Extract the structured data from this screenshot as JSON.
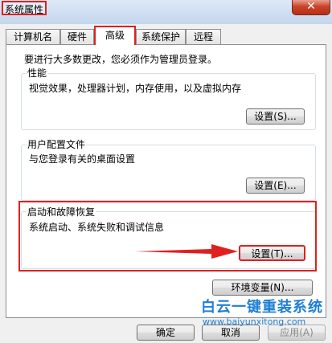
{
  "window": {
    "title": "系统属性",
    "close_glyph": "✕"
  },
  "tabs": [
    {
      "label": "计算机名"
    },
    {
      "label": "硬件"
    },
    {
      "label": "高级"
    },
    {
      "label": "系统保护"
    },
    {
      "label": "远程"
    }
  ],
  "active_tab": "高级",
  "admin_note": "要进行大多数更改，您必须作为管理员登录。",
  "groups": {
    "performance": {
      "label": "性能",
      "description": "视觉效果，处理器计划，内存使用，以及虚拟内存",
      "button": "设置(S)..."
    },
    "user_profiles": {
      "label": "用户配置文件",
      "description": "与您登录有关的桌面设置",
      "button": "设置(E)..."
    },
    "startup_recovery": {
      "label": "启动和故障恢复",
      "description": "系统启动、系统失败和调试信息",
      "button": "设置(T)..."
    }
  },
  "env_button": "环境变量(N)...",
  "footer": {
    "ok": "确定",
    "cancel": "取消",
    "apply": "应用(A)"
  },
  "watermark": {
    "title": "白云一键重装系统",
    "url": "www.baiyunxitong.com"
  },
  "colors": {
    "highlight": "#e02020",
    "watermark": "#1f7fd3"
  },
  "icons": {
    "close": "close-icon",
    "arrow": "arrow-right-icon"
  }
}
